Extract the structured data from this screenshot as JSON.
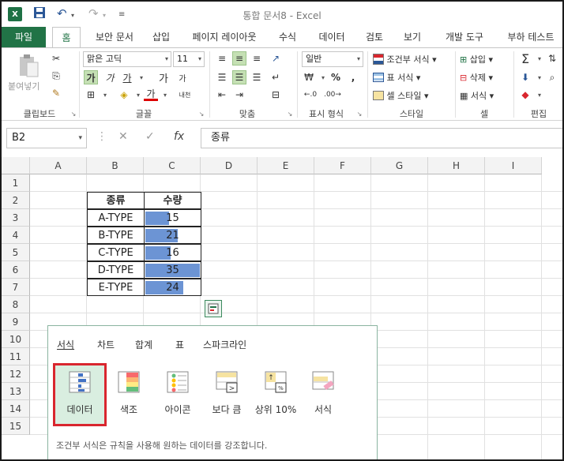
{
  "titlebar": {
    "app_icon": "X",
    "title": "통합 문서8 - Excel"
  },
  "tabs": [
    "파일",
    "홈",
    "보안 문서",
    "삽입",
    "페이지 레이아웃",
    "수식",
    "데이터",
    "검토",
    "보기",
    "개발 도구",
    "부하 테스트"
  ],
  "ribbon": {
    "paste_label": "붙여넣기",
    "font_name": "맑은 고딕",
    "font_size": "11",
    "bold": "가",
    "italic": "가",
    "underline": "가",
    "grow": "가",
    "shrink": "가",
    "font_color": "가",
    "phonetic": "내천",
    "number_format": "일반",
    "conditional_format": "조건부 서식",
    "format_table": "표 서식",
    "cell_styles": "셀 스타일",
    "insert": "삽입",
    "delete": "삭제",
    "format": "서식",
    "groups": {
      "clipboard": "클립보드",
      "font": "글꼴",
      "align": "맞춤",
      "number": "표시 형식",
      "style": "스타일",
      "cells": "셀",
      "edit": "편집"
    }
  },
  "formula_bar": {
    "name_box": "B2",
    "fx": "fx",
    "formula": "종류"
  },
  "grid": {
    "columns": [
      "A",
      "B",
      "C",
      "D",
      "E",
      "F",
      "G",
      "H",
      "I"
    ],
    "rows": [
      "1",
      "2",
      "3",
      "4",
      "5",
      "6",
      "7",
      "8",
      "9",
      "10",
      "11",
      "12",
      "13",
      "14",
      "15"
    ]
  },
  "table": {
    "headers": [
      "종류",
      "수량"
    ],
    "rows": [
      {
        "type": "A-TYPE",
        "qty": "15",
        "fill": 0.43
      },
      {
        "type": "B-TYPE",
        "qty": "21",
        "fill": 0.6
      },
      {
        "type": "C-TYPE",
        "qty": "16",
        "fill": 0.46
      },
      {
        "type": "D-TYPE",
        "qty": "35",
        "fill": 1.0
      },
      {
        "type": "E-TYPE",
        "qty": "24",
        "fill": 0.69
      }
    ]
  },
  "quick_analysis": {
    "tabs": [
      "서식",
      "차트",
      "합계",
      "표",
      "스파크라인"
    ],
    "items": [
      "데이터",
      "색조",
      "아이콘",
      "보다 큼",
      "상위 10%",
      "서식"
    ],
    "description": "조건부 서식은 규칙을 사용해 원하는 데이터를 강조합니다.",
    "colors": {
      "accent": "#217346",
      "selected_border": "#d9262e",
      "bar": "#6c94d4"
    }
  }
}
